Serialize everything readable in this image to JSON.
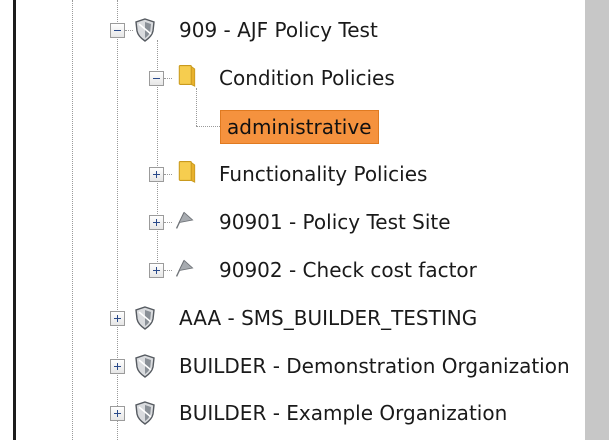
{
  "tree": {
    "nodes": [
      {
        "label": "909 - AJF Policy Test",
        "icon": "shield-icon",
        "state": "expanded"
      },
      {
        "label": "Condition Policies",
        "icon": "folder-icon",
        "state": "expanded"
      },
      {
        "label": "administrative",
        "icon": "none",
        "state": "leaf",
        "selected": true
      },
      {
        "label": "Functionality Policies",
        "icon": "folder-icon",
        "state": "collapsed"
      },
      {
        "label": "90901 - Policy Test Site",
        "icon": "flag-icon",
        "state": "collapsed"
      },
      {
        "label": "90902 - Check cost factor",
        "icon": "flag-icon",
        "state": "collapsed"
      },
      {
        "label": "AAA - SMS_BUILDER_TESTING",
        "icon": "shield-icon",
        "state": "collapsed"
      },
      {
        "label": "BUILDER - Demonstration Organization",
        "icon": "shield-icon",
        "state": "collapsed"
      },
      {
        "label": "BUILDER - Example Organization",
        "icon": "shield-icon",
        "state": "collapsed"
      }
    ]
  },
  "colors": {
    "selection": "#f5923e",
    "folder": "#f3c23c",
    "shield": "#7a7f86"
  }
}
